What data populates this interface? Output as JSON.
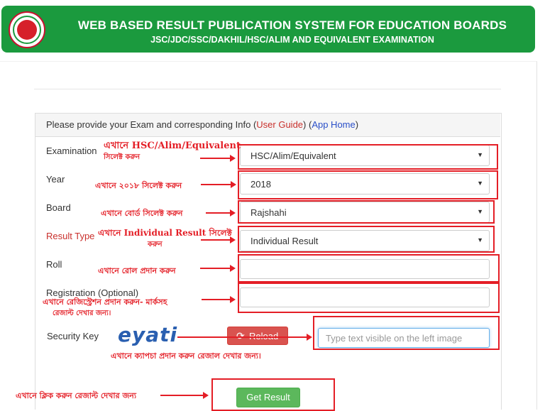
{
  "header": {
    "title": "WEB BASED RESULT PUBLICATION SYSTEM FOR EDUCATION BOARDS",
    "subtitle": "JSC/JDC/SSC/DAKHIL/HSC/ALIM AND EQUIVALENT EXAMINATION"
  },
  "panel": {
    "intro": "Please provide your Exam and corresponding Info (",
    "user_guide": "User Guide",
    "mid": ") (",
    "app_home": "App Home",
    "end": ")"
  },
  "form": {
    "examination_label": "Examination",
    "examination_value": "HSC/Alim/Equivalent",
    "year_label": "Year",
    "year_value": "2018",
    "board_label": "Board",
    "board_value": "Rajshahi",
    "result_type_label": "Result Type",
    "result_type_value": "Individual Result",
    "roll_label": "Roll",
    "roll_value": "",
    "registration_label": "Registration (Optional)",
    "registration_value": "",
    "security_label": "Security Key",
    "captcha_text": "eyati",
    "reload_label": "Reload",
    "security_placeholder": "Type text visible on the left image",
    "submit_label": "Get Result"
  },
  "annotations": {
    "exam_1": "এখানে HSC/Alim/Equivalent",
    "exam_2": "সিলেক্ট করুন",
    "year": "এখানে ২০১৮ সিলেক্ট করুন",
    "board": "এখানে বোর্ড সিলেক্ট করুন",
    "result_1": "এখানে Individual Result সিলেক্ট",
    "result_2": "করুন",
    "roll": "এখানে রোল প্রদান করুন",
    "reg_1": "এখানে রেজিস্ট্রেশন প্রদান করুন- মার্কসহ",
    "reg_2": "রেজাল্ট দেখার জন্য।",
    "captcha": "এখানে ক্যাপচা প্রদান করুন রেজাল দেখার জন্য।",
    "submit": "এখানে ক্লিক করুন রেজাল্ট দেখার জন্য"
  },
  "colors": {
    "header_bg": "#1b9a3e",
    "annotation_red": "#e41e26",
    "reload_bg": "#d9534f",
    "submit_bg": "#5cb85c",
    "link_blue": "#2a4fc8"
  }
}
